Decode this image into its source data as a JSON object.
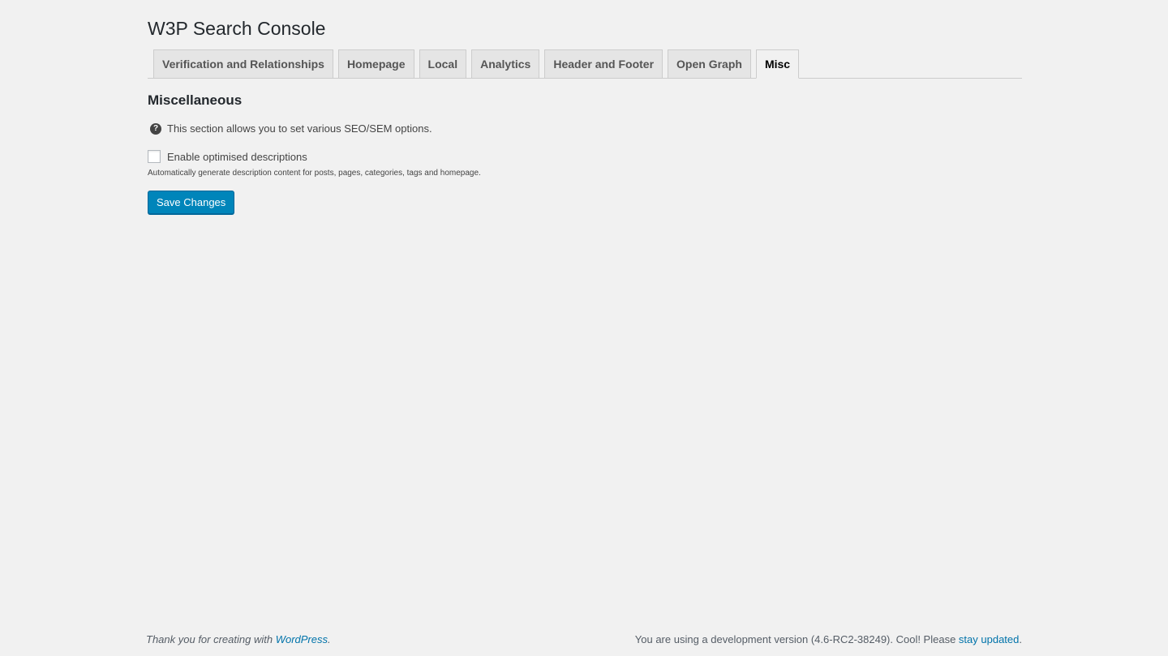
{
  "page": {
    "title": "W3P Search Console"
  },
  "tabs": [
    {
      "label": "Verification and Relationships"
    },
    {
      "label": "Homepage"
    },
    {
      "label": "Local"
    },
    {
      "label": "Analytics"
    },
    {
      "label": "Header and Footer"
    },
    {
      "label": "Open Graph"
    },
    {
      "label": "Misc",
      "active": true
    }
  ],
  "section": {
    "title": "Miscellaneous",
    "info_icon": "help-circle-icon",
    "info_text": "This section allows you to set various SEO/SEM options.",
    "checkbox_label": "Enable optimised descriptions",
    "checkbox_checked": false,
    "description": "Automatically generate description content for posts, pages, categories, tags and homepage.",
    "save_label": "Save Changes"
  },
  "footer": {
    "thanks_prefix": "Thank you for creating with ",
    "thanks_link": "WordPress",
    "thanks_suffix": ".",
    "version_prefix": "You are using a development version (4.6-RC2-38249). Cool! Please ",
    "version_link": "stay updated",
    "version_suffix": "."
  },
  "colors": {
    "background": "#f1f1f1",
    "primary_button": "#0085ba",
    "link": "#0073aa"
  }
}
